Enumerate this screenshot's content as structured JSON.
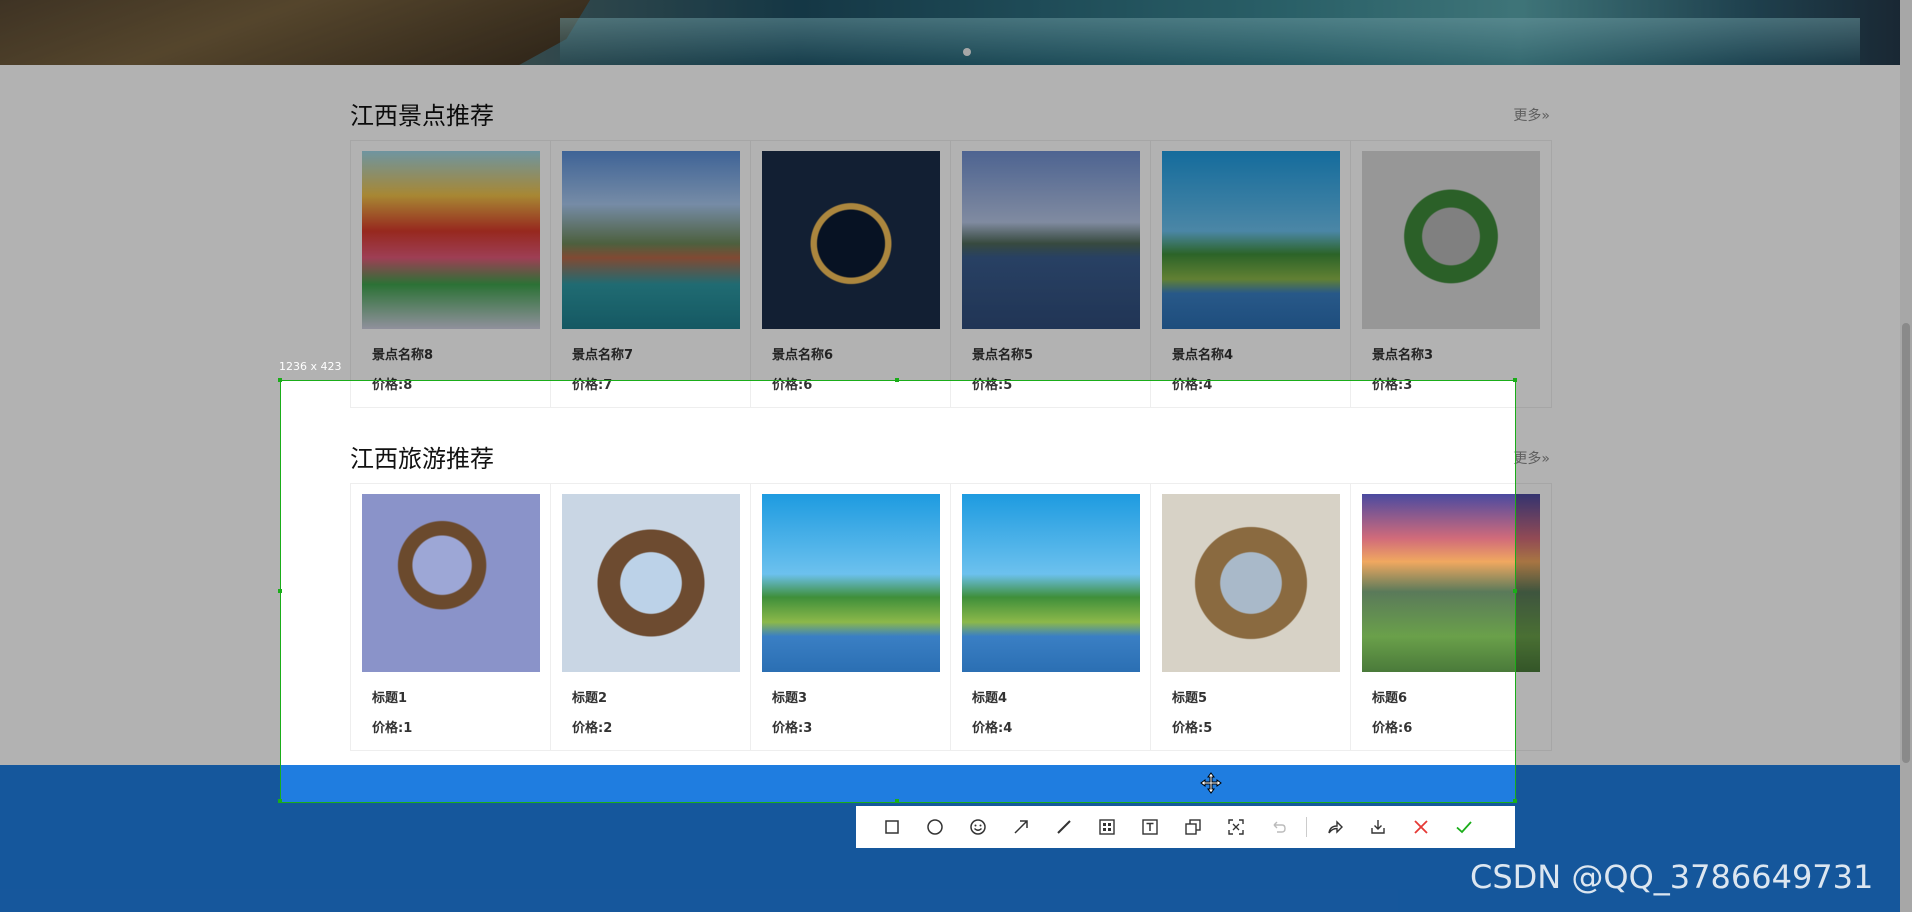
{
  "sections": [
    {
      "title": "江西景点推荐",
      "more": "更多»",
      "cards": [
        {
          "name": "景点名称8",
          "price": "价格:8"
        },
        {
          "name": "景点名称7",
          "price": "价格:7"
        },
        {
          "name": "景点名称6",
          "price": "价格:6"
        },
        {
          "name": "景点名称5",
          "price": "价格:5"
        },
        {
          "name": "景点名称4",
          "price": "价格:4"
        },
        {
          "name": "景点名称3",
          "price": "价格:3"
        }
      ]
    },
    {
      "title": "江西旅游推荐",
      "more": "更多»",
      "cards": [
        {
          "name": "标题1",
          "price": "价格:1"
        },
        {
          "name": "标题2",
          "price": "价格:2"
        },
        {
          "name": "标题3",
          "price": "价格:3"
        },
        {
          "name": "标题4",
          "price": "价格:4"
        },
        {
          "name": "标题5",
          "price": "价格:5"
        },
        {
          "name": "标题6",
          "price": "价格:6"
        }
      ]
    }
  ],
  "capture": {
    "size_label": "1236 x 423",
    "tools": [
      "rectangle-icon",
      "ellipse-icon",
      "emoji-icon",
      "arrow-icon",
      "line-icon",
      "mosaic-icon",
      "text-icon",
      "pin-icon",
      "ocr-icon",
      "undo-icon",
      "share-icon",
      "download-icon",
      "cancel-icon",
      "confirm-icon"
    ]
  },
  "watermark": "CSDN @QQ_3786649731",
  "colors": {
    "footer": "#1f7de0",
    "selection": "#1aad19",
    "cancel": "#e53935",
    "confirm": "#1aad19"
  }
}
